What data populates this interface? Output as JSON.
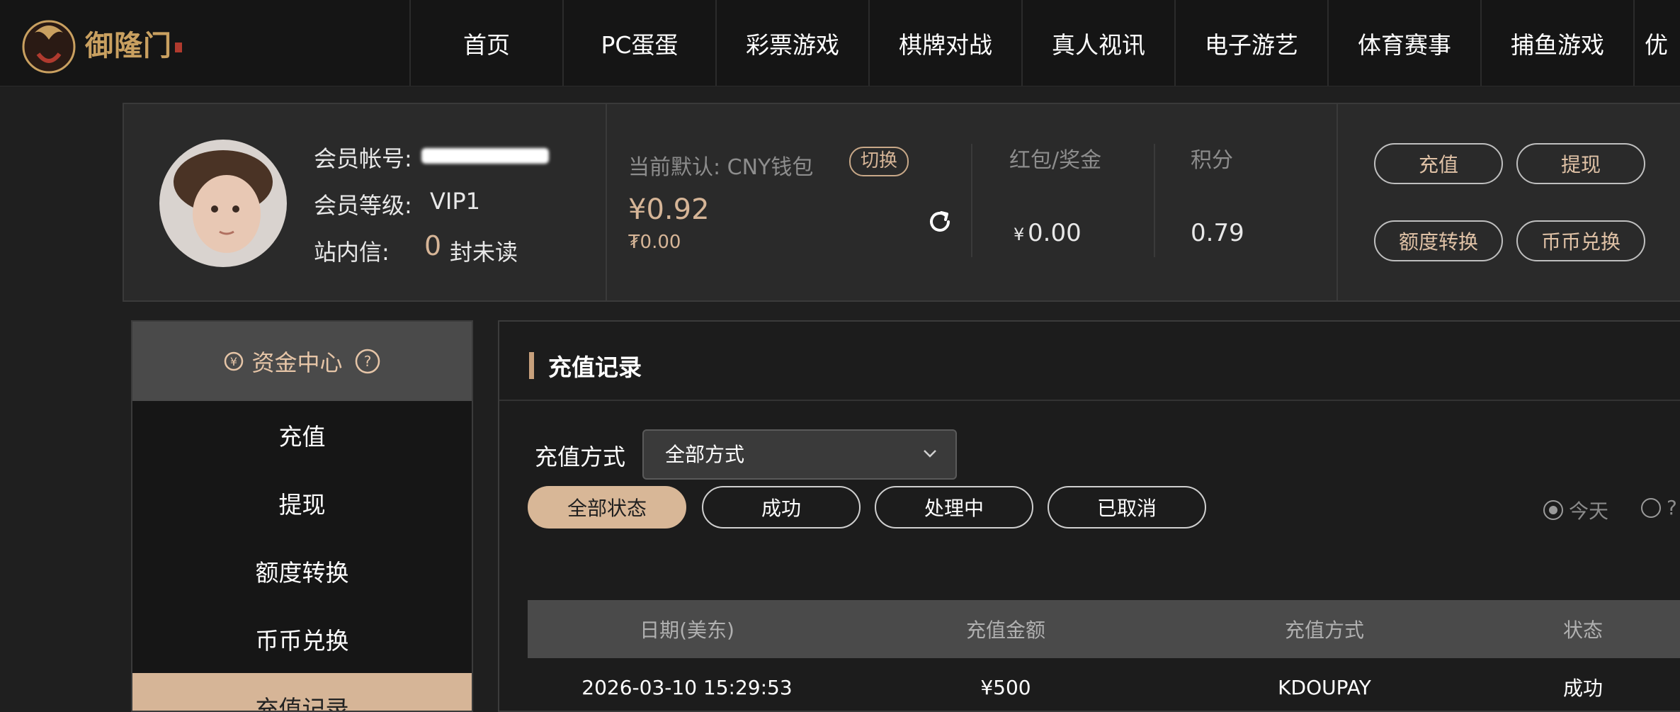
{
  "nav": {
    "logo_text": "御隆门",
    "items": [
      "首页",
      "PC蛋蛋",
      "彩票游戏",
      "棋牌对战",
      "真人视讯",
      "电子游艺",
      "体育赛事",
      "捕鱼游戏",
      "优"
    ]
  },
  "member": {
    "account_label": "会员帐号:",
    "level_label": "会员等级:",
    "level_value": "VIP1",
    "msg_label": "站内信:",
    "msg_count": "0",
    "msg_suffix": "封未读"
  },
  "wallet": {
    "default_label": "当前默认: CNY钱包",
    "switch_label": "切换",
    "balance": "¥0.92",
    "sub_balance": "₮0.00",
    "bonus_label": "红包/奖金",
    "bonus_currency": "¥",
    "bonus_value": "0.00",
    "points_label": "积分",
    "points_value": "0.79"
  },
  "actions": {
    "deposit": "充值",
    "withdraw": "提现",
    "transfer": "额度转换",
    "exchange": "币币兑换"
  },
  "sidebar": {
    "header": "资金中心",
    "items": [
      "充值",
      "提现",
      "额度转换",
      "币币兑换",
      "充值记录"
    ]
  },
  "records": {
    "title": "充值记录",
    "method_label": "充值方式",
    "method_value": "全部方式",
    "filters": [
      "全部状态",
      "成功",
      "处理中",
      "已取消"
    ],
    "radio_today": "今天",
    "radio_other": "?",
    "columns": [
      "日期(美东)",
      "充值金额",
      "充值方式",
      "状态"
    ],
    "rows": [
      [
        "2026-03-10 15:29:53",
        "¥500",
        "KDOUPAY",
        "成功"
      ]
    ]
  },
  "colors": {
    "accent": "#d6b597",
    "nav_bg": "#151515",
    "panel_bg": "#2a2a2a"
  }
}
